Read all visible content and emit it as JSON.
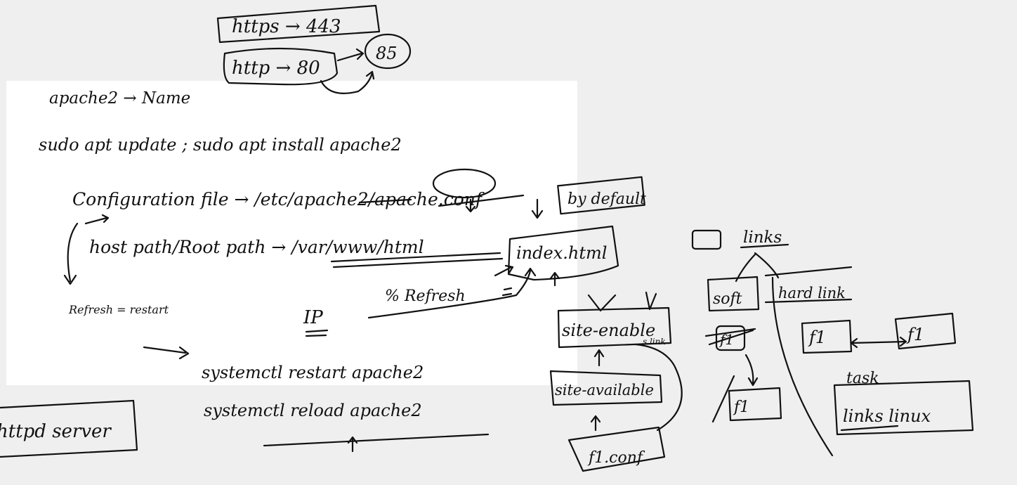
{
  "ports": {
    "https": "https → 443",
    "http": "http → 80",
    "alt": "85"
  },
  "note_apache2": "apache2 → Name",
  "install_cmd": "sudo apt update ; sudo apt install apache2",
  "config_file": "Configuration file → /etc/apache2/apache.conf",
  "root_path": "host path/Root path → /var/www/html",
  "index_file": "index.html",
  "by_default": "by default",
  "refresh_restart": "Refresh = restart",
  "ip": "IP",
  "refresh_pct": "% Refresh",
  "restart_cmd": "systemctl restart apache2",
  "reload_cmd": "systemctl reload apache2",
  "httpd_server": "httpd server",
  "site_enable": "site-enable",
  "site_available": "site-available",
  "f1_conf": "f1.conf",
  "symlink_note": "s.link",
  "links": "links",
  "soft": "soft",
  "hard_link": "hard link",
  "f1_a": "f1",
  "f1_b": "f1",
  "f1_c": "f1",
  "f1_d": "f1",
  "task": "task",
  "links_linux": "links linux"
}
